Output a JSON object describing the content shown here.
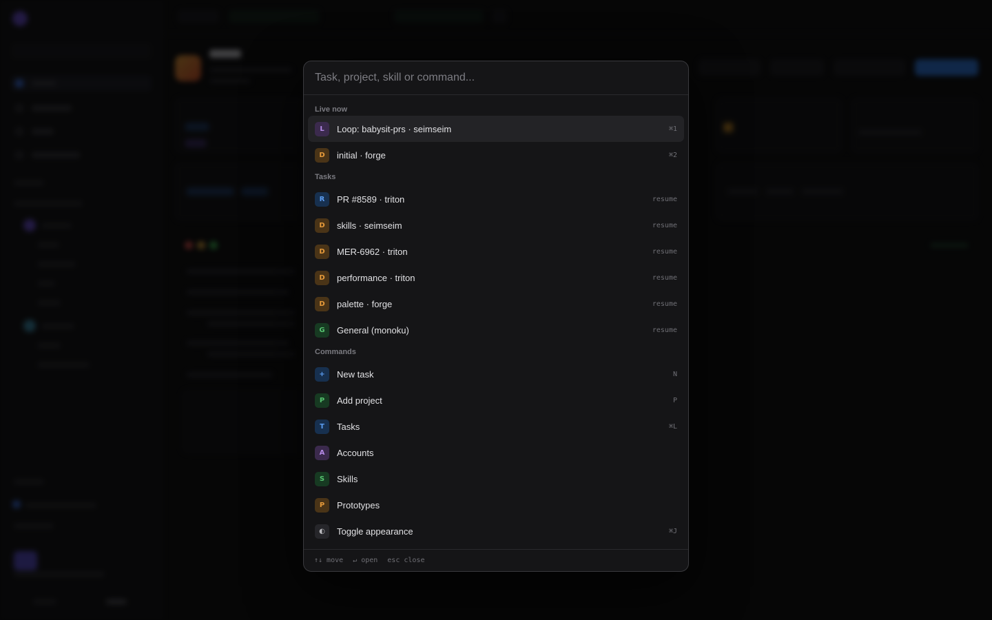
{
  "palette": {
    "search": {
      "placeholder": "Task, project, skill or command..."
    },
    "sections": {
      "live": "Live now",
      "tasks": "Tasks",
      "commands": "Commands"
    },
    "live_items": [
      {
        "badge": "L",
        "label": "Loop: babysit-prs · seimseim",
        "hint": "⌘1"
      },
      {
        "badge": "D",
        "label": "initial · forge",
        "hint": "⌘2"
      }
    ],
    "task_items": [
      {
        "badge": "R",
        "label": "PR #8589 · triton",
        "hint": "resume"
      },
      {
        "badge": "D",
        "label": "skills · seimseim",
        "hint": "resume"
      },
      {
        "badge": "D",
        "label": "MER-6962 · triton",
        "hint": "resume"
      },
      {
        "badge": "D",
        "label": "performance · triton",
        "hint": "resume"
      },
      {
        "badge": "D",
        "label": "palette · forge",
        "hint": "resume"
      },
      {
        "badge": "G",
        "label": "General (monoku)",
        "hint": "resume"
      }
    ],
    "command_items": [
      {
        "badge": "+",
        "label": "New task",
        "hint": "N"
      },
      {
        "badge": "P",
        "label": "Add project",
        "hint": "P"
      },
      {
        "badge": "T",
        "label": "Tasks",
        "hint": "⌘L"
      },
      {
        "badge": "A",
        "label": "Accounts",
        "hint": ""
      },
      {
        "badge": "S",
        "label": "Skills",
        "hint": ""
      },
      {
        "badge": "P",
        "label": "Prototypes",
        "hint": ""
      },
      {
        "badge": "◐",
        "label": "Toggle appearance",
        "hint": "⌘J"
      }
    ],
    "footer": {
      "move": "↑↓ move",
      "open": "↵ open",
      "close": "esc close"
    }
  },
  "colors": {
    "accent_blue": "#2f7be6",
    "badge_purple": "#b48ae6",
    "badge_orange": "#e69a3a",
    "badge_blue": "#5b9cf0",
    "badge_green": "#56c26f"
  }
}
